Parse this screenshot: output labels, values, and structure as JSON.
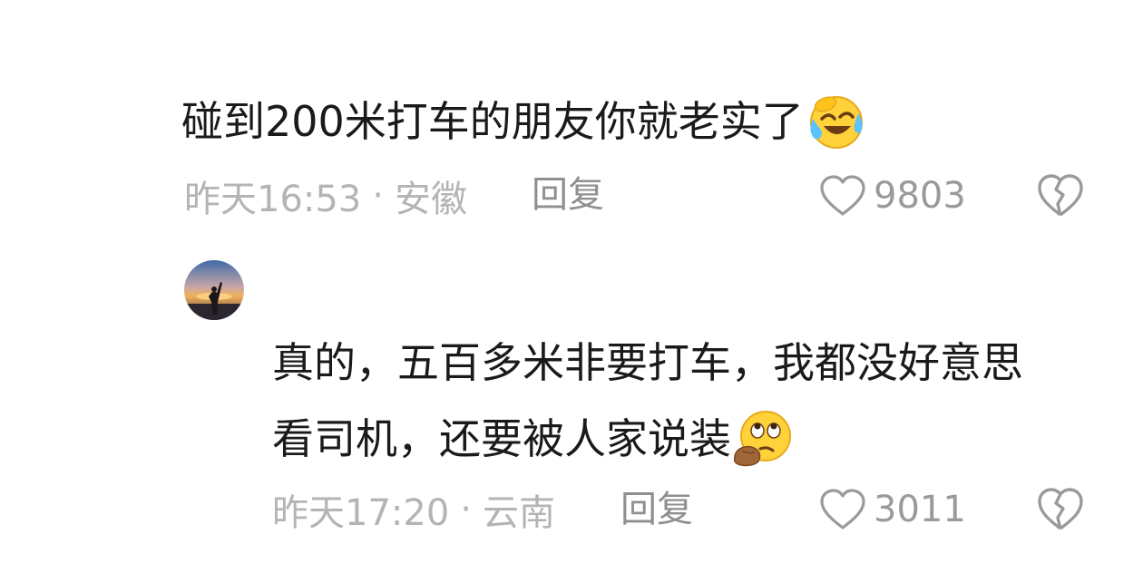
{
  "comments": [
    {
      "text": "碰到200米打车的朋友你就老实了",
      "emoji": "laughing-crying-emoji",
      "time": "昨天16:53",
      "dot": "·",
      "location": "安徽",
      "reply_label": "回复",
      "likes": "9803"
    },
    {
      "text_line1": "真的，五百多米非要打车，我都没好意思",
      "text_line2": "看司机，还要被人家说装",
      "emoji": "eye-roll-hand-emoji",
      "time": "昨天17:20",
      "dot": "·",
      "location": "云南",
      "reply_label": "回复",
      "likes": "3011",
      "avatar": "sunset-silhouette-avatar"
    }
  ],
  "colors": {
    "text": "#1a1a1a",
    "meta": "#b4b4b4",
    "reply": "#8f8f8f",
    "icon": "#9a9a9a"
  }
}
